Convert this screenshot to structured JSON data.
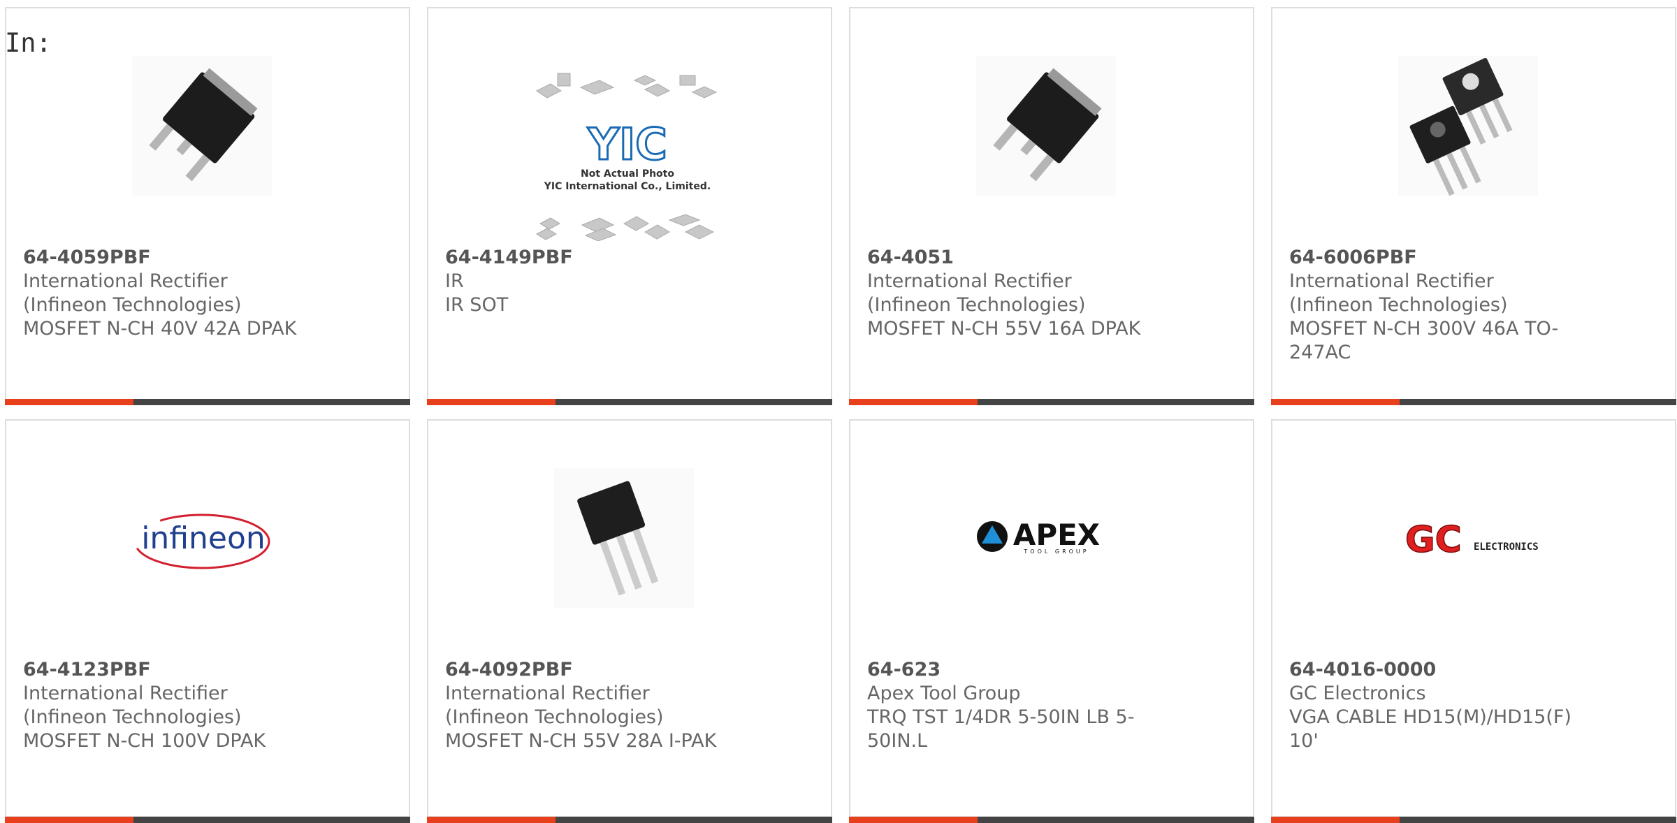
{
  "page": {
    "in_label": "In:"
  },
  "colors": {
    "accent": "#e8401c",
    "bar": "#444444",
    "border": "#dddddd",
    "text": "#666666"
  },
  "products": [
    {
      "part_number": "64-4059PBF",
      "manufacturer": "International Rectifier (Infineon Technologies)",
      "description": "MOSFET N-CH 40V 42A DPAK",
      "image": "dpak-component-icon"
    },
    {
      "part_number": "64-4149PBF",
      "manufacturer": "IR",
      "description": "IR SOT",
      "image": "not-actual-photo-placeholder",
      "image_text": {
        "logo": "YIC",
        "line1": "Not Actual Photo",
        "line2": "YIC International Co., Limited."
      }
    },
    {
      "part_number": "64-4051",
      "manufacturer": "International Rectifier (Infineon Technologies)",
      "description": "MOSFET N-CH 55V 16A DPAK",
      "image": "dpak-component-icon"
    },
    {
      "part_number": "64-6006PBF",
      "manufacturer": "International Rectifier (Infineon Technologies)",
      "description": "MOSFET N-CH 300V 46A TO-247AC",
      "image": "to247-component-icon"
    },
    {
      "part_number": "64-4123PBF",
      "manufacturer": "International Rectifier (Infineon Technologies)",
      "description": "MOSFET N-CH 100V DPAK",
      "image": "infineon-logo",
      "image_text": "infineon"
    },
    {
      "part_number": "64-4092PBF",
      "manufacturer": "International Rectifier (Infineon Technologies)",
      "description": "MOSFET N-CH 55V 28A I-PAK",
      "image": "ipak-component-icon"
    },
    {
      "part_number": "64-623",
      "manufacturer": "Apex Tool Group",
      "description": "TRQ TST 1/4DR 5-50IN LB 5-50IN.L",
      "image": "apex-logo",
      "image_text": {
        "main": "APEX",
        "sub": "TOOL GROUP"
      }
    },
    {
      "part_number": "64-4016-0000",
      "manufacturer": "GC Electronics",
      "description": "VGA CABLE HD15(M)/HD15(F) 10'",
      "image": "gc-electronics-logo",
      "image_text": {
        "main": "GC",
        "sub": "ELECTRONICS"
      }
    }
  ]
}
